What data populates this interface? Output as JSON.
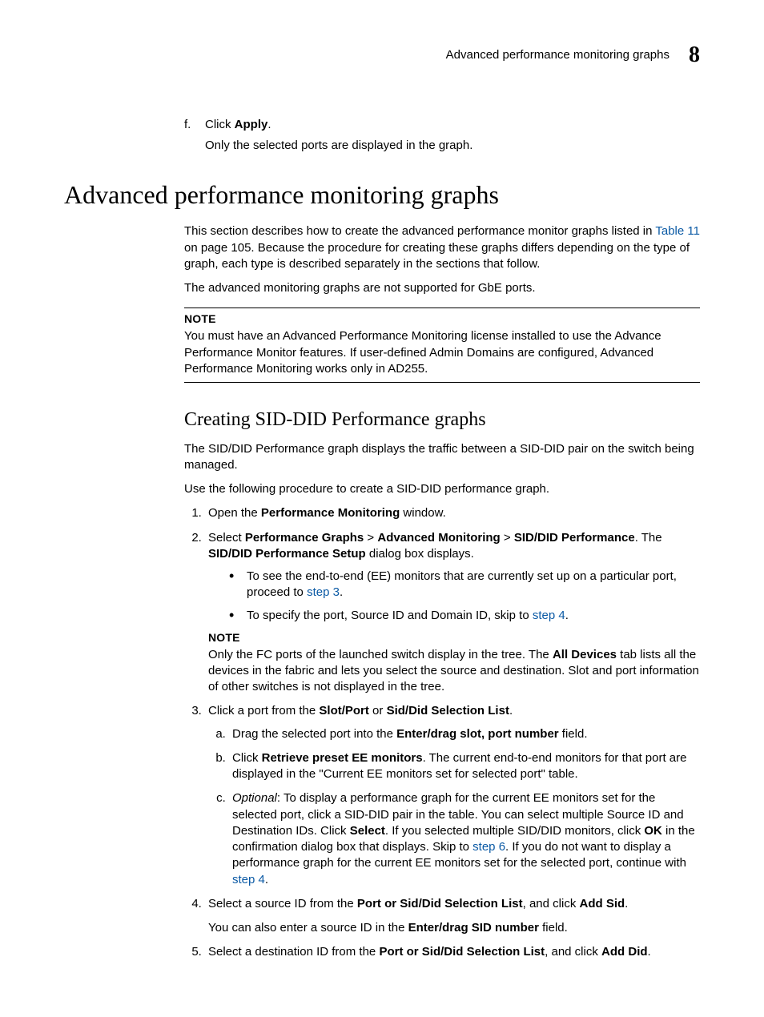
{
  "header": {
    "title": "Advanced performance monitoring graphs",
    "chapter": "8"
  },
  "top": {
    "f_marker": "f.",
    "f_prefix": "Click ",
    "f_bold": "Apply",
    "f_suffix": ".",
    "f_note": "Only the selected ports are displayed in the graph."
  },
  "h1": "Advanced performance monitoring graphs",
  "intro": {
    "p1a": "This section describes how to create the advanced performance monitor graphs listed in ",
    "p1_link": "Table 11",
    "p1b": " on page 105. Because the procedure for creating these graphs differs depending on the type of graph, each type is described separately in the sections that follow.",
    "p2": "The advanced monitoring graphs are not supported for GbE ports."
  },
  "note1": {
    "label": "NOTE",
    "text": "You must have an Advanced Performance Monitoring license installed to use the Advance Performance Monitor features. If user-defined Admin Domains are configured, Advanced Performance Monitoring works only in AD255."
  },
  "h2": "Creating SID-DID Performance graphs",
  "sid": {
    "p1": "The SID/DID Performance graph displays the traffic between a SID-DID pair on the switch being managed.",
    "p2": "Use the following procedure to create a SID-DID performance graph."
  },
  "step1": {
    "a": "Open the ",
    "b": "Performance Monitoring",
    "c": " window."
  },
  "step2": {
    "a": "Select ",
    "b": "Performance Graphs",
    "gt1": " > ",
    "c": "Advanced Monitoring",
    "gt2": " > ",
    "d": "SID/DID Performance",
    "e": ". The ",
    "f": "SID/DID Performance Setup",
    "g": " dialog box displays."
  },
  "bullet1": {
    "a": "To see the end-to-end (EE) monitors that are currently set up on a particular port, proceed to ",
    "link": "step 3",
    "b": "."
  },
  "bullet2": {
    "a": "To specify the port, Source ID and Domain ID, skip to ",
    "link": "step 4",
    "b": "."
  },
  "note2": {
    "label": "NOTE",
    "a": "Only the FC ports of the launched switch display in the tree. The ",
    "b": "All Devices",
    "c": " tab lists all the devices in the fabric and lets you select the source and destination. Slot and port information of other switches is not displayed in the tree."
  },
  "step3": {
    "a": "Click a port from the ",
    "b": "Slot/Port",
    "c": " or ",
    "d": "Sid/Did Selection List",
    "e": "."
  },
  "step3a": {
    "a": "Drag the selected port into the ",
    "b": "Enter/drag slot, port number",
    "c": " field."
  },
  "step3b": {
    "a": "Click ",
    "b": "Retrieve preset EE monitors",
    "c": ". The current end-to-end monitors for that port are displayed in the \"Current EE monitors set for selected port\" table."
  },
  "step3c": {
    "opt": "Optional",
    "a": ": To display a performance graph for the current EE monitors set for the selected port, click a SID-DID pair in the table. You can select multiple Source ID and Destination IDs. Click ",
    "b": "Select",
    "c": ". If you selected multiple SID/DID monitors, click ",
    "d": "OK",
    "e": " in the confirmation dialog box that displays. Skip to ",
    "link1": "step 6",
    "f": ". If you do not want to display a performance graph for the current EE monitors set for the selected port, continue with ",
    "link2": "step 4",
    "g": "."
  },
  "step4": {
    "a": "Select a source ID from the ",
    "b": "Port or Sid/Did Selection List",
    "c": ", and click ",
    "d": "Add Sid",
    "e": "."
  },
  "step4_note": {
    "a": "You can also enter a source ID in the ",
    "b": "Enter/drag SID number",
    "c": " field."
  },
  "step5": {
    "a": "Select a destination ID from the ",
    "b": "Port or Sid/Did Selection List",
    "c": ", and click ",
    "d": "Add Did",
    "e": "."
  }
}
